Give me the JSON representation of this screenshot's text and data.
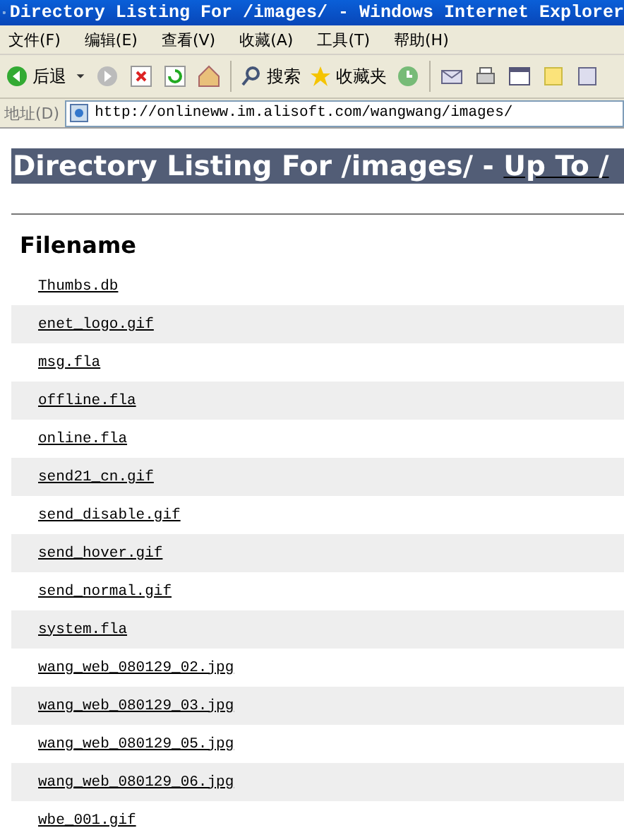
{
  "window": {
    "title": "Directory Listing For /images/ - Windows Internet Explorer"
  },
  "menu": [
    "文件(F)",
    "编辑(E)",
    "查看(V)",
    "收藏(A)",
    "工具(T)",
    "帮助(H)"
  ],
  "toolbar": {
    "back": "后退",
    "search": "搜索",
    "favorites": "收藏夹"
  },
  "address": {
    "label": "地址(D)",
    "value": "http://onlineww.im.alisoft.com/wangwang/images/"
  },
  "page": {
    "heading": "Directory Listing For /images/ - ",
    "up_link": "Up To /",
    "column": "Filename",
    "files": [
      "Thumbs.db",
      "enet_logo.gif",
      "msg.fla",
      "offline.fla",
      "online.fla",
      "send21_cn.gif",
      "send_disable.gif",
      "send_hover.gif",
      "send_normal.gif",
      "system.fla",
      "wang_web_080129_02.jpg",
      "wang_web_080129_03.jpg",
      "wang_web_080129_05.jpg",
      "wang_web_080129_06.jpg",
      "wbe_001.gif"
    ]
  }
}
